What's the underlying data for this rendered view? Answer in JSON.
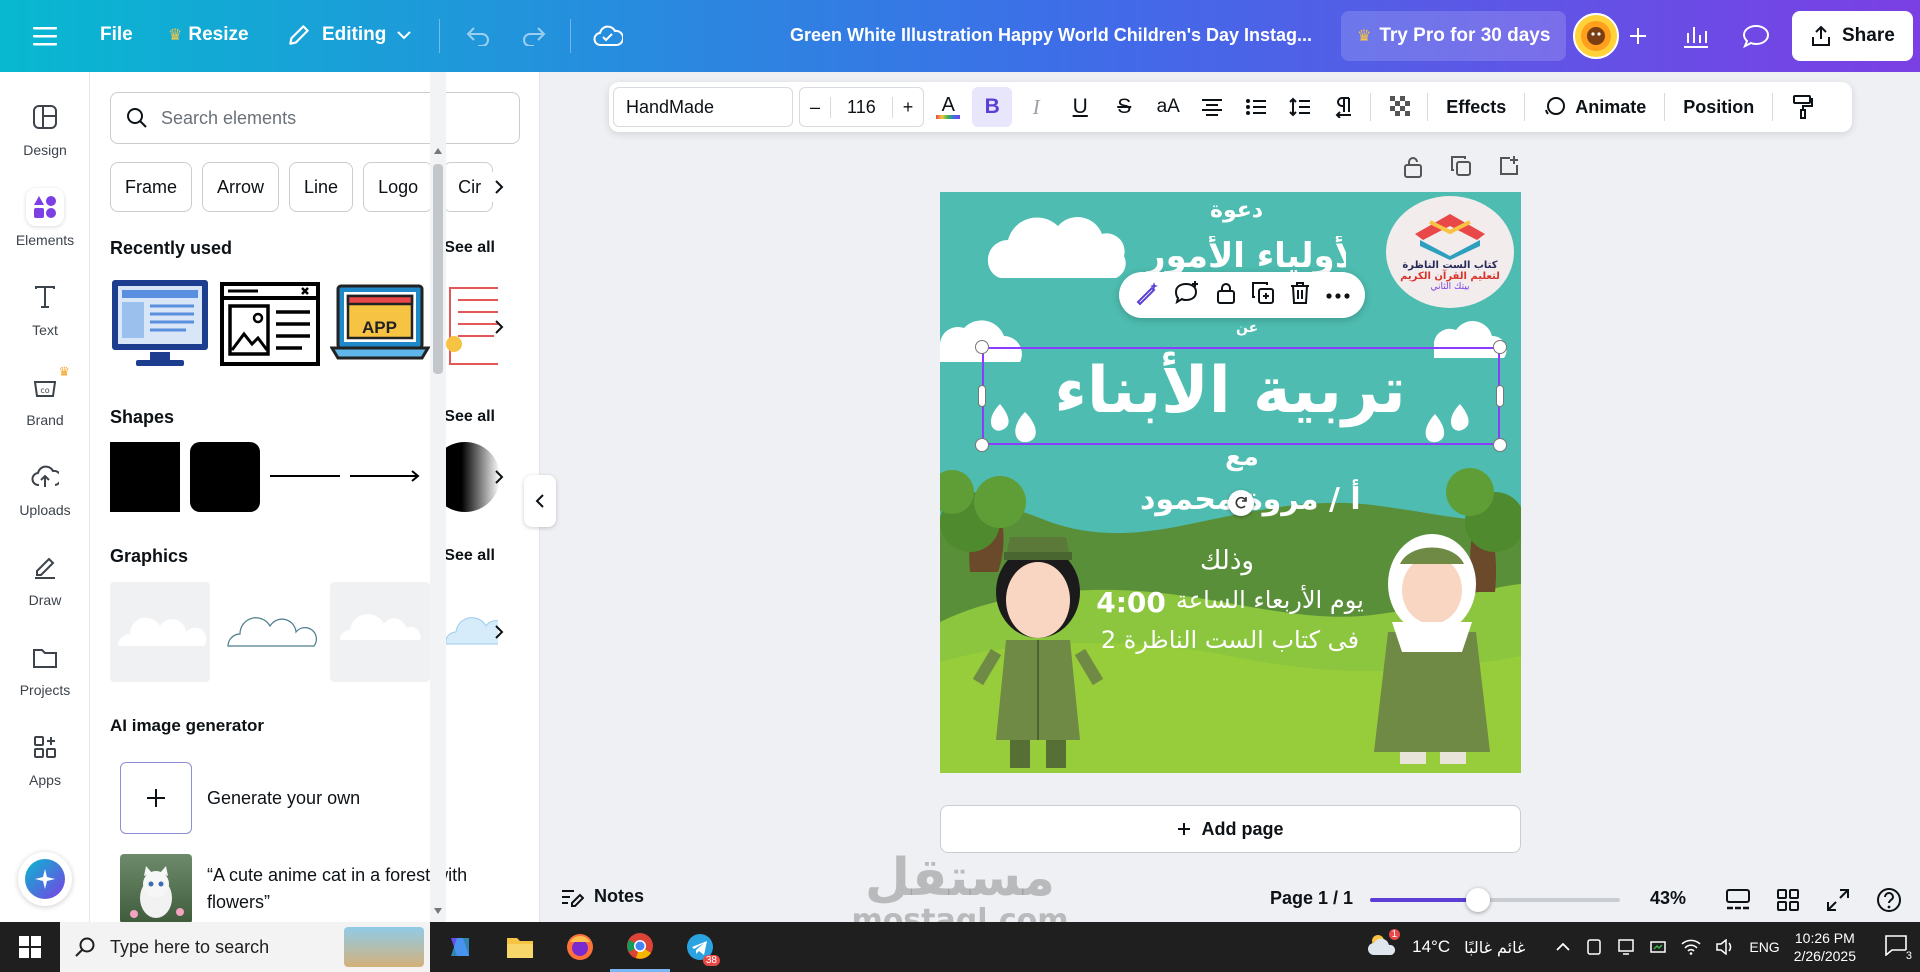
{
  "topbar": {
    "file_label": "File",
    "resize_label": "Resize",
    "editing_label": "Editing",
    "doc_title": "Green White Illustration Happy World Children's Day Instag...",
    "try_pro_label": "Try Pro for 30 days",
    "share_label": "Share"
  },
  "rail": {
    "items": [
      {
        "label": "Design"
      },
      {
        "label": "Elements"
      },
      {
        "label": "Text"
      },
      {
        "label": "Brand"
      },
      {
        "label": "Uploads"
      },
      {
        "label": "Draw"
      },
      {
        "label": "Projects"
      },
      {
        "label": "Apps"
      }
    ]
  },
  "panel": {
    "search_placeholder": "Search elements",
    "chips": [
      "Frame",
      "Arrow",
      "Line",
      "Logo",
      "Cir"
    ],
    "recently_used_title": "Recently used",
    "shapes_title": "Shapes",
    "graphics_title": "Graphics",
    "see_all": "See all",
    "ai_title": "AI image generator",
    "generate_label": "Generate your own",
    "ai_example": "“A cute anime cat in a forest with flowers”",
    "app_thumb_label": "APP"
  },
  "format_bar": {
    "font_name": "HandMade",
    "font_size": "116",
    "minus": "–",
    "plus": "+",
    "bold": "B",
    "italic": "I",
    "underline": "U",
    "strike": "S",
    "case": "aA",
    "effects_label": "Effects",
    "animate_label": "Animate",
    "position_label": "Position"
  },
  "design": {
    "line_invite": "دعوة",
    "line_parents": "لأولياء الأمور",
    "line_about": "عن",
    "line_main": "تربية الأبناء",
    "line_with": "مع",
    "line_name": "أ / مروة محمود",
    "line_and": "وذلك",
    "line_day": "يوم الأربعاء الساعة",
    "line_time": "4:00",
    "line_place": "فى كتاب الست الناظرة 2",
    "logo_line1": "كتاب الست الناظرة",
    "logo_line2": "لتعليم القرآن الكريم",
    "logo_line3": "بيتك الثاني"
  },
  "canvas": {
    "add_page_label": "Add page"
  },
  "bottombar": {
    "notes_label": "Notes",
    "page_label": "Page 1 / 1",
    "zoom_value": 0.43,
    "zoom_label": "43%"
  },
  "watermark": {
    "brand_ar": "مستقل",
    "brand_en": "mostaql.com"
  },
  "taskbar": {
    "search_placeholder": "Type here to search",
    "telegram_badge": "38",
    "weather_badge": "1",
    "temperature": "14°C",
    "weather_desc": "غائم غالبًا",
    "lang": "ENG",
    "time": "10:26 PM",
    "date": "2/26/2025",
    "notif_count": "3"
  },
  "colors": {
    "accent": "#8b3dff",
    "design_bg": "#4ebcb0",
    "grass": "#8cc63f",
    "gradient_start": "#08b8d0",
    "gradient_end": "#7b3fe4"
  }
}
